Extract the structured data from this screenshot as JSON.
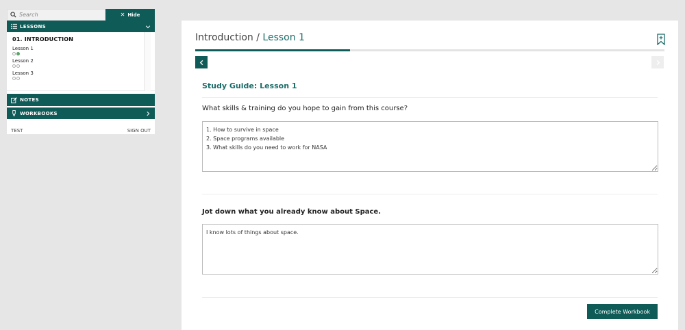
{
  "sidebar": {
    "search_placeholder": "Search",
    "hide_label": "Hide",
    "lessons_header": "LESSONS",
    "module_title": "01. INTRODUCTION",
    "lessons": [
      {
        "name": "Lesson 1",
        "dots": [
          false,
          true
        ]
      },
      {
        "name": "Lesson 2",
        "dots": [
          false,
          false
        ]
      },
      {
        "name": "Lesson 3",
        "dots": [
          false,
          false
        ]
      }
    ],
    "notes_header": "NOTES",
    "workbooks_header": "WORKBOOKS",
    "user_label": "TEST",
    "signout_label": "SIGN OUT"
  },
  "main": {
    "breadcrumb_section": "Introduction",
    "breadcrumb_separator": " / ",
    "breadcrumb_lesson": "Lesson 1",
    "progress_fraction": 0.33,
    "guide_title": "Study Guide: Lesson 1",
    "question1": "What skills & training do you hope to gain from this course?",
    "answer1": "1. How to survive in space\n2. Space programs available\n3. What skills do you need to work for NASA",
    "question2": "Jot down what you already know about Space.",
    "answer2": "I know lots of things about space.",
    "complete_label": "Complete Workbook"
  },
  "colors": {
    "accent": "#0f5b58",
    "accent_text": "#1a6c68",
    "done_dot": "#5aa469"
  }
}
